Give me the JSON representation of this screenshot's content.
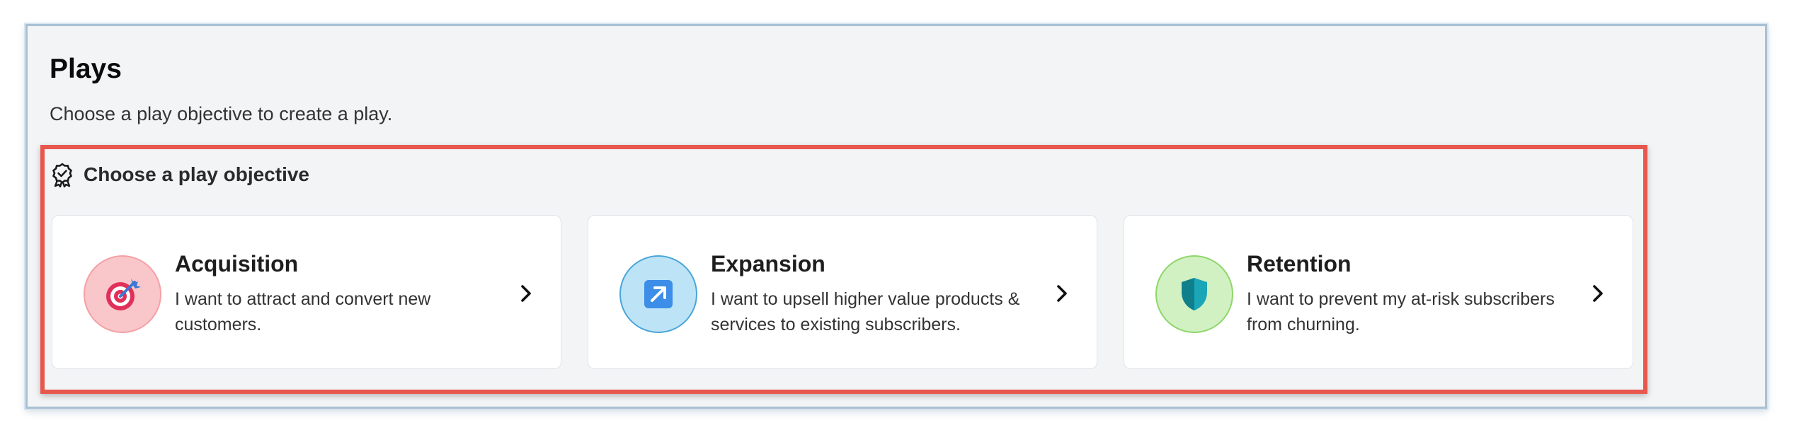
{
  "page": {
    "title": "Plays",
    "subtitle": "Choose a play objective to create a play."
  },
  "section": {
    "title": "Choose a play objective",
    "icon": "award-badge-icon"
  },
  "objectives": [
    {
      "title": "Acquisition",
      "description": "I want to attract and convert new customers.",
      "icon": "target-icon",
      "icon_bg": "#f9c6c9",
      "icon_border": "#f4a1a6"
    },
    {
      "title": "Expansion",
      "description": "I want to upsell higher value products & services to existing subscribers.",
      "icon": "arrow-up-right-icon",
      "icon_bg": "#bde3f6",
      "icon_border": "#4aa6d8"
    },
    {
      "title": "Retention",
      "description": "I want to prevent my at-risk subscribers from churning.",
      "icon": "shield-icon",
      "icon_bg": "#d2f1c2",
      "icon_border": "#8ed66a"
    }
  ],
  "colors": {
    "highlight": "#e8574d",
    "frame_border": "#a9c1d3",
    "background": "#f3f4f6"
  }
}
